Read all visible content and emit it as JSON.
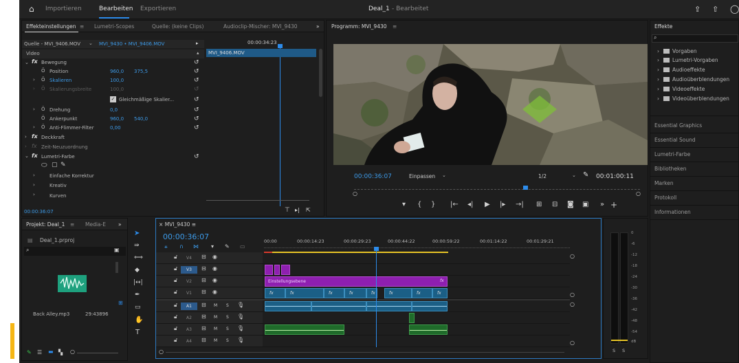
{
  "topbar": {
    "tabs": [
      "Importieren",
      "Bearbeiten",
      "Exportieren"
    ],
    "title": "Deal_1",
    "subtitle": "- Bearbeitet"
  },
  "effect_controls": {
    "tabs": [
      "Effekteinstellungen",
      "Lumetri-Scopes",
      "Quelle: (keine Clips)",
      "Audioclip-Mischer: MVI_9430"
    ],
    "source_label": "Quelle - MVI_9406.MOV",
    "sequence_label": "MVI_9430 • MVI_9406.MOV",
    "time_ruler": "00:00:34:23",
    "clip_name": "MVI_9406.MOV",
    "section_video": "Video",
    "rows": {
      "bewegung": "Bewegung",
      "position": "Position",
      "position_x": "960,0",
      "position_y": "375,5",
      "skalieren": "Skalieren",
      "skalieren_val": "100,0",
      "skalierungsbreite": "Skalierungsbreite",
      "skalierungsbreite_val": "100,0",
      "gleichmaessig": "Gleichmäßige Skalier...",
      "drehung": "Drehung",
      "drehung_val": "0,0",
      "ankerpunkt": "Ankerpunkt",
      "anker_x": "960,0",
      "anker_y": "540,0",
      "antiflimmer": "Anti-Flimmer-Filter",
      "antiflimmer_val": "0,00",
      "deckkraft": "Deckkraft",
      "zeit": "Zeit-Neuzuordnung",
      "lumetri": "Lumetri-Farbe",
      "einfache": "Einfache Korrektur",
      "kreativ": "Kreativ",
      "kurven": "Kurven"
    },
    "timecode": "00:00:36:07"
  },
  "program": {
    "title": "Programm: MVI_9430",
    "timecode": "00:00:36:07",
    "fit": "Einpassen",
    "resolution": "1/2",
    "duration": "00:01:00:11"
  },
  "effects_panel": {
    "title": "Effekte",
    "items": [
      "Vorgaben",
      "Lumetri-Vorgaben",
      "Audioeffekte",
      "Audioüberblendungen",
      "Videoeffekte",
      "Videoüberblendungen"
    ],
    "sections": [
      "Essential Graphics",
      "Essential Sound",
      "Lumetri-Farbe",
      "Bibliotheken",
      "Marken",
      "Protokoll",
      "Informationen"
    ]
  },
  "project": {
    "tabs": [
      "Projekt: Deal_1",
      "Media-E"
    ],
    "file": "Deal_1.prproj",
    "clip_name": "Back Alley.mp3",
    "clip_duration": "29:43896"
  },
  "timeline": {
    "tab": "MVI_9430",
    "timecode": "00:00:36:07",
    "ruler": [
      "00:00",
      "00:00:14:23",
      "00:00:29:23",
      "00:00:44:22",
      "00:00:59:22",
      "00:01:14:22",
      "00:01:29:21"
    ],
    "video_tracks": [
      "V4",
      "V3",
      "V2",
      "V1"
    ],
    "audio_tracks": [
      "A1",
      "A2",
      "A3",
      "A4"
    ],
    "adjustment_label": "Einstellungsebene",
    "fx": "fx",
    "track_m": "M",
    "track_s": "S"
  },
  "meter": {
    "scale": [
      "0",
      "-6",
      "-12",
      "-18",
      "-24",
      "-30",
      "-36",
      "-42",
      "-48",
      "-54",
      "dB"
    ],
    "solo": [
      "S",
      "S"
    ]
  },
  "colors": {
    "accent": "#2d8ceb",
    "bg": "#1d1d1d",
    "clip_blue": "#1b5f86",
    "clip_purple": "#8e1fb0",
    "clip_green": "#1f6b2a",
    "highlight_bar": "#f5b615"
  }
}
